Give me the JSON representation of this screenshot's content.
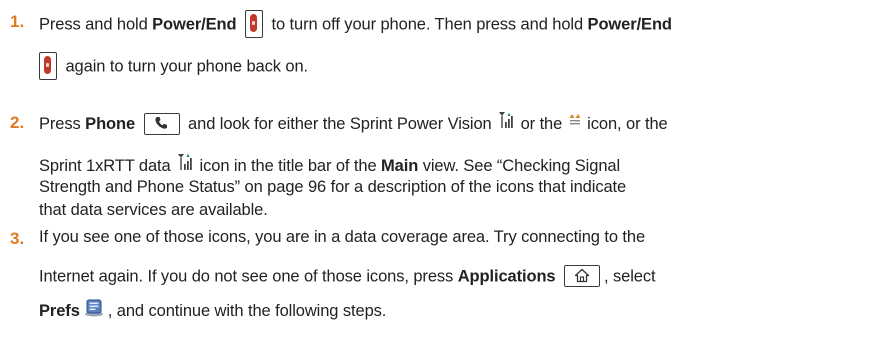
{
  "steps": [
    {
      "number": "1.",
      "t1": "Press and hold ",
      "b1": "Power/End",
      "t2": " to turn off your phone. Then press and hold ",
      "b2": "Power/End",
      "t3": " again to turn your phone back on."
    },
    {
      "number": "2.",
      "t1": "Press ",
      "b1": "Phone",
      "t2": " and look for either the Sprint Power Vision ",
      "t3": " or the ",
      "t4": " icon, or the",
      "t5": "Sprint 1xRTT data ",
      "t6": " icon in the title bar of the ",
      "b2": "Main",
      "t7": " view. See “Checking Signal",
      "t8": "Strength and Phone Status” on page 96 for a description of the icons that indicate",
      "t9": "that data services are available."
    },
    {
      "number": "3.",
      "t1": "If you see one of those icons, you are in a data coverage area. Try connecting to the",
      "t2": "Internet again. If you do not see one of those icons, press ",
      "b1": "Applications",
      "t3": ", select",
      "b2": "Prefs",
      "t4": ", and continue with the following steps."
    }
  ],
  "icons": {
    "power": "power-end-key-icon",
    "phone": "phone-key-icon",
    "power_vision": "sprint-power-vision-icon",
    "evdo": "data-arrows-icon",
    "rtt": "sprint-1xrtt-data-icon",
    "applications": "applications-home-key-icon",
    "prefs": "prefs-icon"
  },
  "colors": {
    "step_number": "#e07a1f",
    "text": "#222222",
    "power_key": "#c0392b",
    "icon_accent": "#2a8a4a"
  }
}
